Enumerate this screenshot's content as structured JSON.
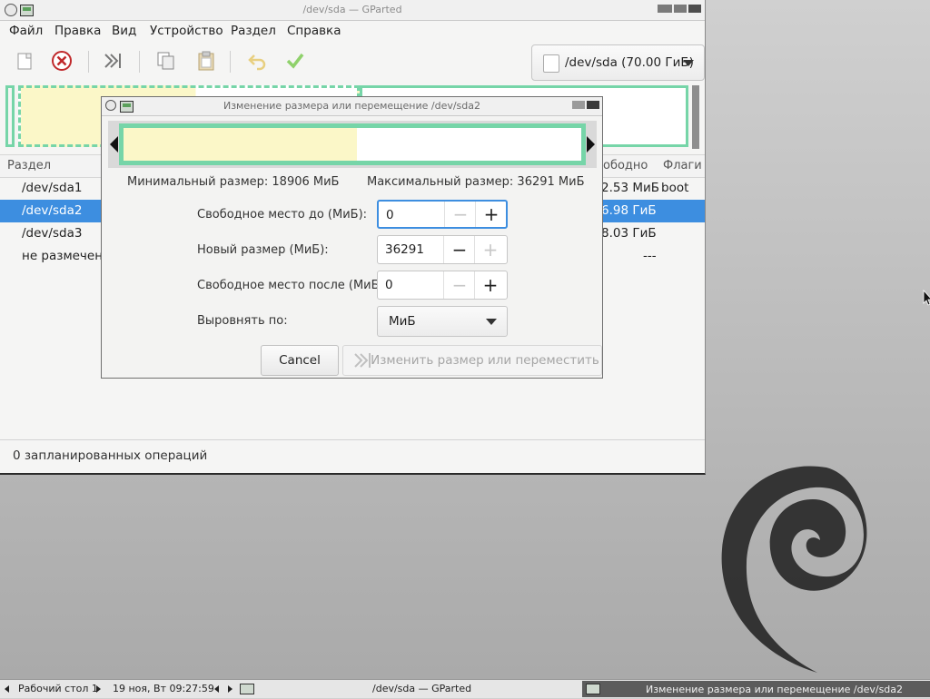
{
  "main_window": {
    "title": "/dev/sda — GParted",
    "menu": [
      "Файл",
      "Правка",
      "Вид",
      "Устройство",
      "Раздел",
      "Справка"
    ],
    "toolbar_icons": [
      "new-icon",
      "delete-icon",
      "resize-move-icon",
      "copy-icon",
      "paste-icon",
      "undo-icon",
      "apply-icon"
    ],
    "device_selector": "/dev/sda (70.00 ГиБ)",
    "table": {
      "headers": {
        "partition": "Раздел",
        "free": "ободно",
        "flags": "Флаги"
      },
      "rows": [
        {
          "name": "/dev/sda1",
          "free": "2.53 МиБ",
          "flags": "boot",
          "selected": false
        },
        {
          "name": "/dev/sda2",
          "free": "6.98 ГиБ",
          "flags": "",
          "selected": true
        },
        {
          "name": "/dev/sda3",
          "free": "8.03 ГиБ",
          "flags": "",
          "selected": false
        },
        {
          "name": "не размечено",
          "free": "---",
          "flags": "",
          "selected": false
        }
      ]
    },
    "status": "0 запланированных операций"
  },
  "dialog": {
    "title": "Изменение размера или перемещение /dev/sda2",
    "min_size": "Минимальный размер: 18906 МиБ",
    "max_size": "Максимальный размер: 36291 МиБ",
    "used_fraction": 0.51,
    "fields": {
      "free_before_label": "Свободное место до (МиБ):",
      "free_before_value": "0",
      "new_size_label": "Новый размер (МиБ):",
      "new_size_value": "36291",
      "free_after_label": "Свободное место после (МиБ):",
      "free_after_value": "0",
      "align_label": "Выровнять по:",
      "align_value": "МиБ"
    },
    "buttons": {
      "cancel": "Cancel",
      "resize": "Изменить размер или переместить"
    }
  },
  "taskbar": {
    "desktop": "Рабочий стол 1",
    "clock": "19 ноя, Вт 09:27:59",
    "task1": "/dev/sda — GParted",
    "task2": "Изменение размера или перемещение /dev/sda2"
  },
  "colors": {
    "accent": "#3d8ee0",
    "partition_border": "#76d5a8",
    "used_space": "#fbf7c8"
  }
}
